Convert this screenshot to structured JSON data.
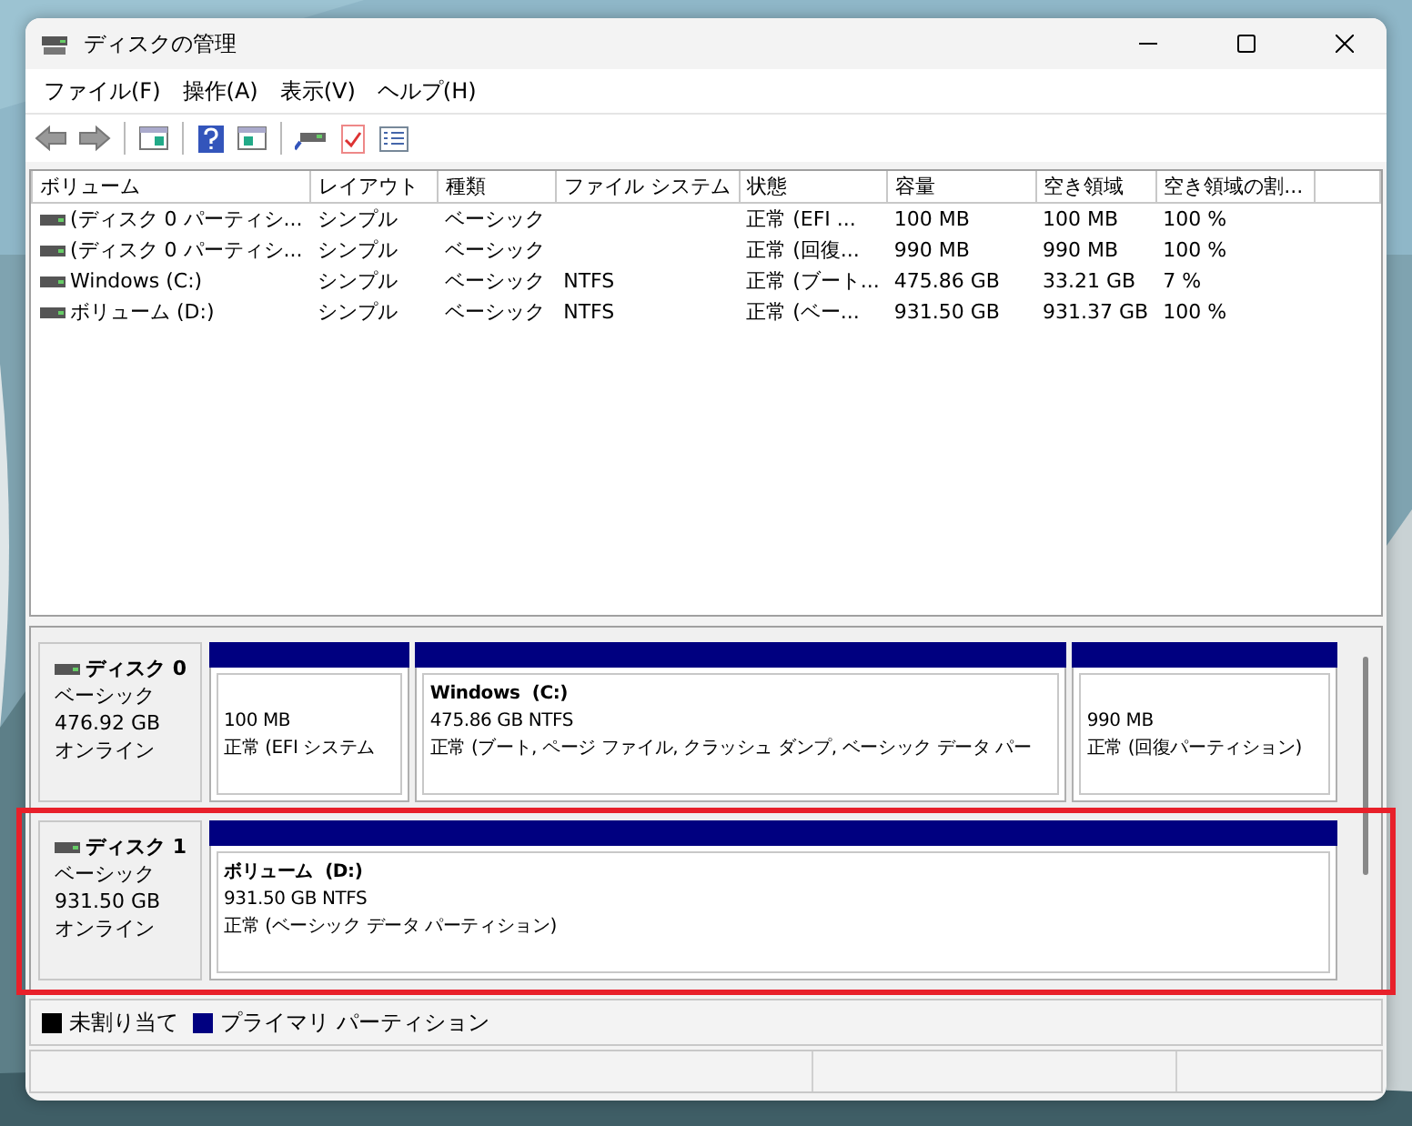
{
  "window": {
    "title": "ディスクの管理"
  },
  "menu": [
    "ファイル(F)",
    "操作(A)",
    "表示(V)",
    "ヘルプ(H)"
  ],
  "volume_table": {
    "columns": [
      "ボリューム",
      "レイアウト",
      "種類",
      "ファイル システム",
      "状態",
      "容量",
      "空き領域",
      "空き領域の割..."
    ],
    "rows": [
      {
        "cells": [
          "(ディスク 0 パーティシ...",
          "シンプル",
          "ベーシック",
          "",
          "正常 (EFI ...",
          "100 MB",
          "100 MB",
          "100 %"
        ]
      },
      {
        "cells": [
          "(ディスク 0 パーティシ...",
          "シンプル",
          "ベーシック",
          "",
          "正常 (回復...",
          "990 MB",
          "990 MB",
          "100 %"
        ]
      },
      {
        "cells": [
          "Windows (C:)",
          "シンプル",
          "ベーシック",
          "NTFS",
          "正常 (ブート...",
          "475.86 GB",
          "33.21 GB",
          "7 %"
        ]
      },
      {
        "cells": [
          "ボリューム (D:)",
          "シンプル",
          "ベーシック",
          "NTFS",
          "正常 (ベー...",
          "931.50 GB",
          "931.37 GB",
          "100 %"
        ]
      }
    ]
  },
  "disks": [
    {
      "name": "ディスク 0",
      "type": "ベーシック",
      "size": "476.92 GB",
      "status": "オンライン",
      "highlighted": false,
      "partitions": [
        {
          "size": "100 MB",
          "status": "正常 (EFI システム",
          "color": "#000080"
        },
        {
          "title": "Windows  (C:)",
          "size": "475.86 GB NTFS",
          "status": "正常 (ブート, ページ ファイル, クラッシュ ダンプ, ベーシック データ パー",
          "color": "#000080"
        },
        {
          "size": "990 MB",
          "status": "正常 (回復パーティション)",
          "color": "#000080"
        }
      ]
    },
    {
      "name": "ディスク 1",
      "type": "ベーシック",
      "size": "931.50 GB",
      "status": "オンライン",
      "highlighted": true,
      "partitions": [
        {
          "title": "ボリューム  (D:)",
          "size": "931.50 GB NTFS",
          "status": "正常 (ベーシック データ パーティション)",
          "color": "#000080"
        }
      ]
    }
  ],
  "legend": [
    {
      "label": "未割り当て",
      "color": "#000000"
    },
    {
      "label": "プライマリ パーティション",
      "color": "#000080"
    }
  ]
}
